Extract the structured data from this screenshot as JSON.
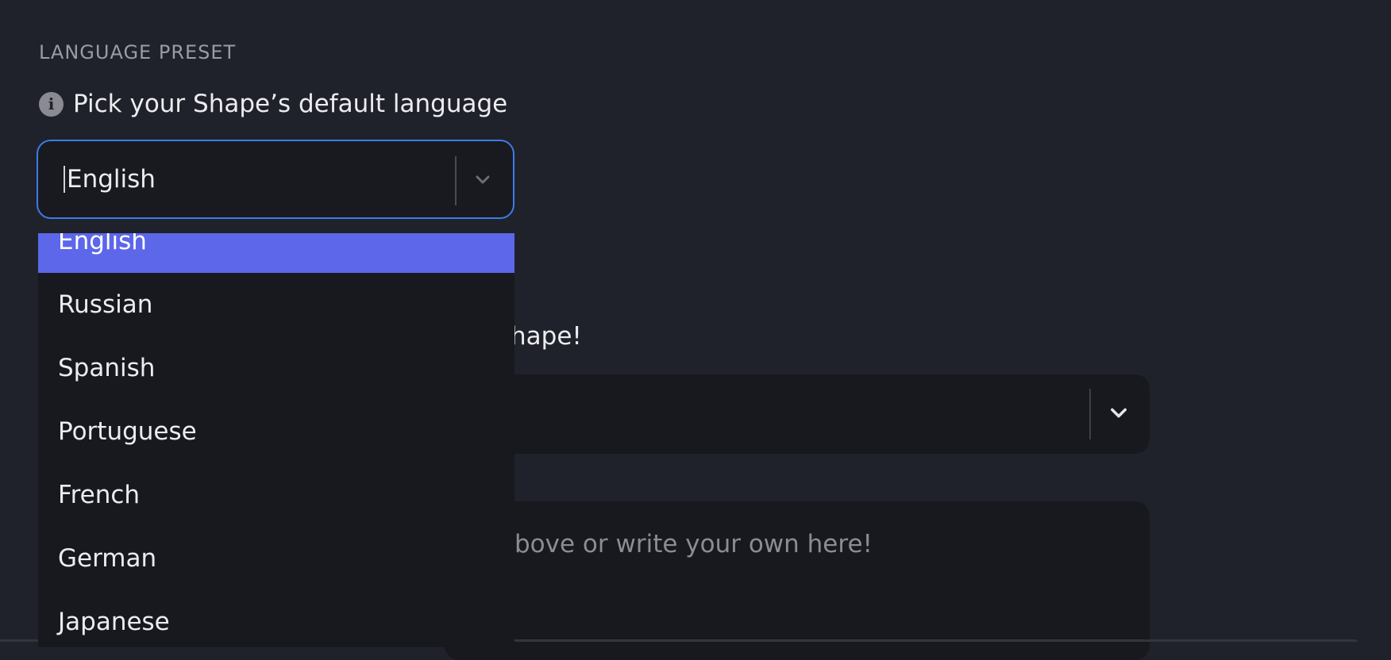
{
  "section": {
    "label": "LANGUAGE PRESET"
  },
  "hint": {
    "icon": "info-icon",
    "text": "Pick your Shape’s default language"
  },
  "language_select": {
    "value": "English",
    "icon": "chevron-down-icon",
    "options": [
      "English",
      "Russian",
      "Spanish",
      "Portuguese",
      "French",
      "German",
      "Japanese"
    ],
    "selected_index": 0
  },
  "background": {
    "label_fragment": "hape!",
    "voice_select_icon": "chevron-down-icon",
    "prompt_placeholder_fragment": "bove or write your own here!"
  },
  "colors": {
    "background": "#20222b",
    "focus_border": "#3d7be8",
    "selected_option": "#5d67ea",
    "field_bg": "#18191e"
  }
}
